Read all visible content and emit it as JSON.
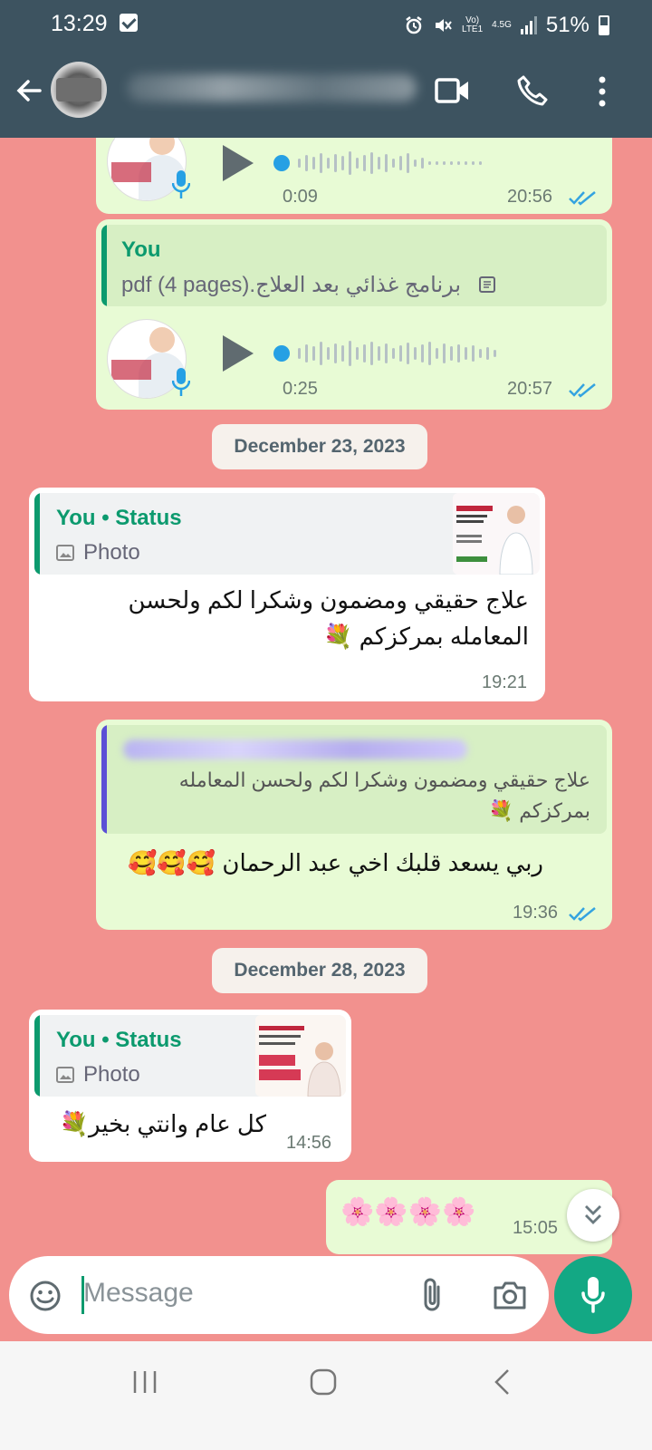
{
  "status_bar": {
    "time": "13:29",
    "network_top": "Vo)",
    "network_bottom": "LTE1",
    "signal_type": "4.5G",
    "battery": "51%"
  },
  "header": {
    "contact_name": "",
    "icons": [
      "back-arrow-icon",
      "video-call-icon",
      "voice-call-icon",
      "more-options-icon"
    ]
  },
  "messages": {
    "m1": {
      "type": "voice",
      "duration": "0:09",
      "time": "20:56"
    },
    "m2": {
      "type": "voice",
      "quote_author": "You",
      "quote_text": "pdf (4 pages).برنامج غذائي  بعد العلاج",
      "duration": "0:25",
      "time": "20:57"
    },
    "date1": "December 23, 2023",
    "m3": {
      "quote_author": "You • Status",
      "quote_media": "Photo",
      "text": "علاج حقيقي ومضمون وشكرا لكم ولحسن المعامله بمركزكم 💐",
      "time": "19:21"
    },
    "m4": {
      "quote_text": "علاج حقيقي ومضمون وشكرا لكم ولحسن المعامله بمركزكم 💐",
      "text": "ربي يسعد قلبك اخي عبد الرحمان 🥰🥰🥰",
      "time": "19:36"
    },
    "date2": "December 28, 2023",
    "m5": {
      "quote_author": "You • Status",
      "quote_media": "Photo",
      "text": "كل عام وانتي بخير💐",
      "time": "14:56"
    },
    "m6": {
      "text": "🌸🌸🌸🌸",
      "time": "15:05"
    }
  },
  "composer": {
    "placeholder": "Message"
  },
  "colors": {
    "header": "#3d5360",
    "wallpaper": "#f2918e",
    "outgoing_bubble": "#e8fbd5",
    "incoming_bubble": "#ffffff",
    "accent": "#13a884",
    "read_ticks": "#34a3e0"
  }
}
